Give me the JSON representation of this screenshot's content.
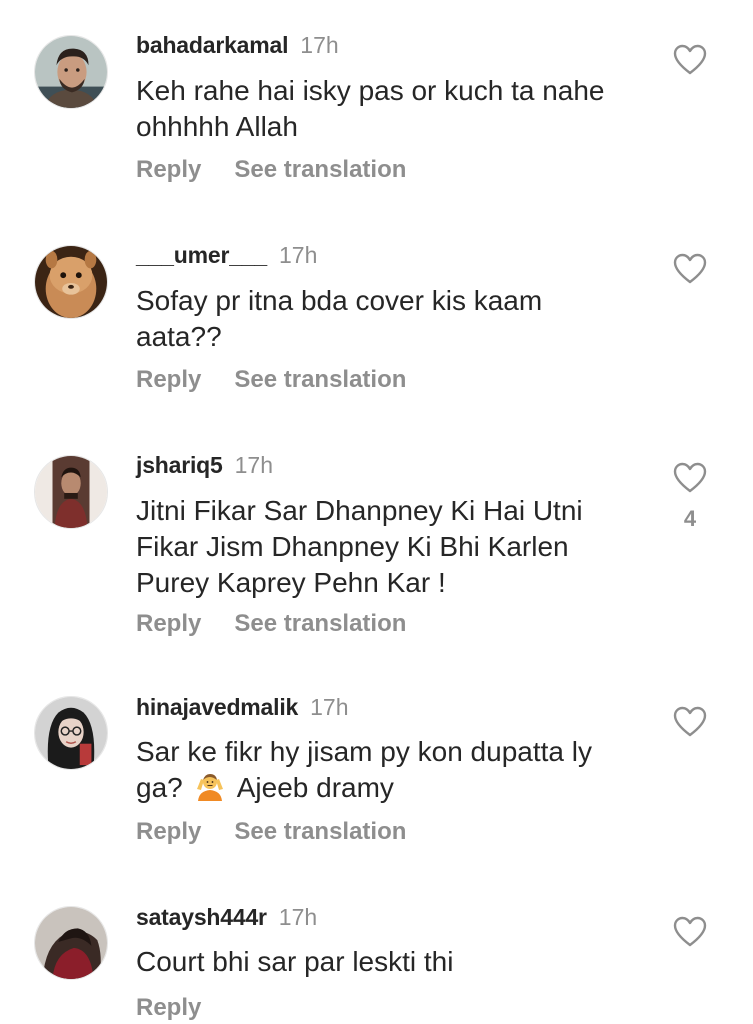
{
  "comments": [
    {
      "username": "bahadarkamal",
      "time": "17h",
      "text_lines": [
        "Keh rahe hai isky pas or kuch ta nahe",
        "ohhhhh Allah"
      ],
      "reply_label": "Reply",
      "translate_label": "See translation",
      "likes": ""
    },
    {
      "username": "___umer___",
      "time": "17h",
      "text_lines": [
        "Sofay pr itna bda cover kis kaam",
        "aata??"
      ],
      "reply_label": "Reply",
      "translate_label": "See translation",
      "likes": ""
    },
    {
      "username": "jshariq5",
      "time": "17h",
      "text_lines": [
        "Jitni Fikar Sar Dhanpney Ki Hai Utni",
        "Fikar Jism Dhanpney Ki Bhi Karlen",
        "Purey Kaprey Pehn Kar !"
      ],
      "reply_label": "Reply",
      "translate_label": "See translation",
      "likes": "4"
    },
    {
      "username": "hinajavedmalik",
      "time": "17h",
      "text_line1": "Sar ke fikr hy jisam py kon dupatta ly",
      "text_line2_before": "ga?",
      "text_line2_emoji": "person-shrugging-emoji",
      "text_line2_after": "Ajeeb dramy",
      "reply_label": "Reply",
      "translate_label": "See translation",
      "likes": ""
    },
    {
      "username": "sataysh444r",
      "time": "17h",
      "text_lines": [
        "Court bhi sar par leskti thi"
      ],
      "reply_label": "Reply",
      "likes": ""
    }
  ],
  "icons": {
    "like": "heart-outline-icon"
  },
  "colors": {
    "text": "#262626",
    "secondary": "#8e8e8e",
    "background": "#ffffff"
  }
}
